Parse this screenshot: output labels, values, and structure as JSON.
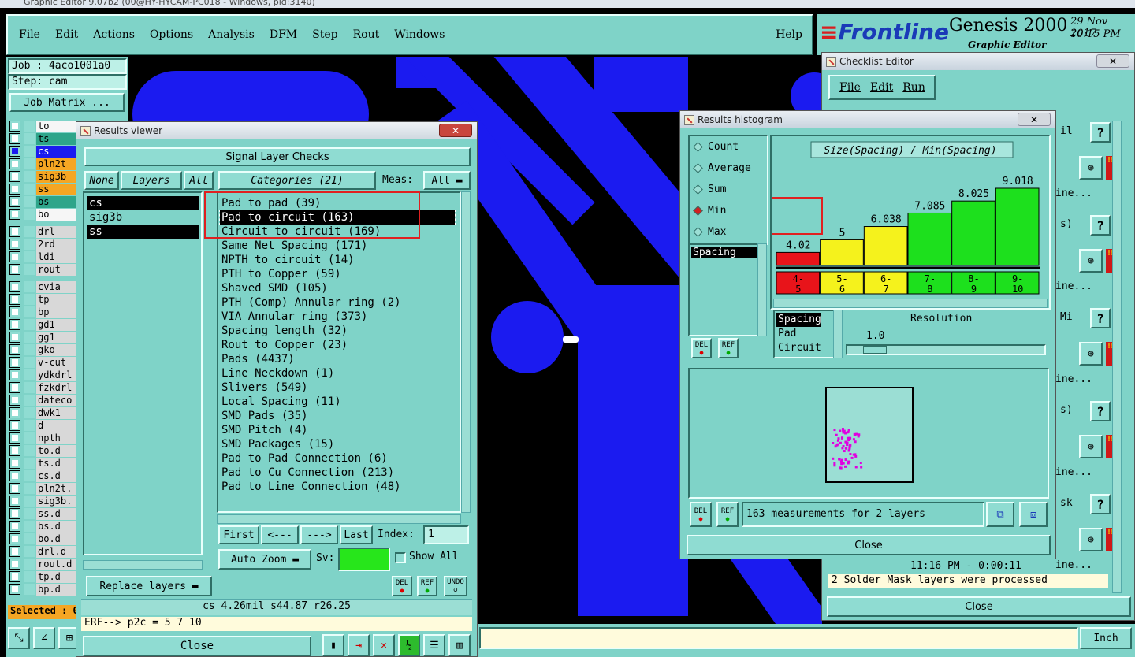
{
  "app": {
    "title": "Graphic Editor 9.07b2 (00@HY-HYCAM-PC018 - Windows, pid:3140)",
    "menu": [
      "File",
      "Edit",
      "Actions",
      "Options",
      "Analysis",
      "DFM",
      "Step",
      "Rout",
      "Windows"
    ],
    "help": "Help",
    "brand": "Frontline",
    "product": "Genesis 2000",
    "subtitle": "Graphic Editor",
    "date": "29 Nov 2017",
    "time": "10:15 PM"
  },
  "job": {
    "job": "Job : 4aco1001a0",
    "step": "Step: cam",
    "matrix_btn": "Job Matrix ..."
  },
  "layers": [
    {
      "name": "to",
      "color": "#f6f6f6",
      "sel": false
    },
    {
      "name": "ts",
      "color": "#2ea58a",
      "sel": false
    },
    {
      "name": "cs",
      "color": "#f5a623",
      "sel": true
    },
    {
      "name": "pln2t",
      "color": "#f5a623",
      "sel": false
    },
    {
      "name": "sig3b",
      "color": "#f5a623",
      "sel": false
    },
    {
      "name": "ss",
      "color": "#f5a623",
      "sel": false
    },
    {
      "name": "bs",
      "color": "#2ea58a",
      "sel": false
    },
    {
      "name": "bo",
      "color": "#f6f6f6",
      "sel": false
    },
    {
      "name": "drl",
      "color": "#d8d8d8",
      "sel": false
    },
    {
      "name": "2rd",
      "color": "#d8d8d8",
      "sel": false
    },
    {
      "name": "ldi",
      "color": "#d8d8d8",
      "sel": false
    },
    {
      "name": "rout",
      "color": "#d8d8d8",
      "sel": false
    },
    {
      "name": "cvia",
      "color": "#d8d8d8",
      "sel": false
    },
    {
      "name": "tp",
      "color": "#d8d8d8",
      "sel": false
    },
    {
      "name": "bp",
      "color": "#d8d8d8",
      "sel": false
    },
    {
      "name": "gd1",
      "color": "#d8d8d8",
      "sel": false
    },
    {
      "name": "gg1",
      "color": "#d8d8d8",
      "sel": false
    },
    {
      "name": "gko",
      "color": "#d8d8d8",
      "sel": false
    },
    {
      "name": "v-cut",
      "color": "#d8d8d8",
      "sel": false
    },
    {
      "name": "ydkdrl",
      "color": "#d8d8d8",
      "sel": false
    },
    {
      "name": "fzkdrl",
      "color": "#d8d8d8",
      "sel": false
    },
    {
      "name": "dateco",
      "color": "#d8d8d8",
      "sel": false
    },
    {
      "name": "dwk1",
      "color": "#d8d8d8",
      "sel": false
    },
    {
      "name": "d",
      "color": "#d8d8d8",
      "sel": false
    },
    {
      "name": "npth",
      "color": "#d8d8d8",
      "sel": false
    },
    {
      "name": "to.d",
      "color": "#d8d8d8",
      "sel": false
    },
    {
      "name": "ts.d",
      "color": "#d8d8d8",
      "sel": false
    },
    {
      "name": "cs.d",
      "color": "#d8d8d8",
      "sel": false
    },
    {
      "name": "pln2t.",
      "color": "#d8d8d8",
      "sel": false
    },
    {
      "name": "sig3b.",
      "color": "#d8d8d8",
      "sel": false
    },
    {
      "name": "ss.d",
      "color": "#d8d8d8",
      "sel": false
    },
    {
      "name": "bs.d",
      "color": "#d8d8d8",
      "sel": false
    },
    {
      "name": "bo.d",
      "color": "#d8d8d8",
      "sel": false
    },
    {
      "name": "drl.d",
      "color": "#d8d8d8",
      "sel": false
    },
    {
      "name": "rout.d",
      "color": "#d8d8d8",
      "sel": false
    },
    {
      "name": "tp.d",
      "color": "#d8d8d8",
      "sel": false
    },
    {
      "name": "bp.d",
      "color": "#d8d8d8",
      "sel": false
    }
  ],
  "selected_label": "Selected : 0",
  "results_viewer": {
    "title": "Results viewer",
    "header": "Signal Layer Checks",
    "none": "None",
    "layers": "Layers",
    "all": "All",
    "categories_btn": "Categories (21)",
    "meas_label": "Meas:",
    "meas_value": "All",
    "layer_list": [
      "cs",
      "sig3b",
      "ss"
    ],
    "categories": [
      "Pad to pad (39)",
      "Pad to circuit (163)",
      "Circuit to circuit (169)",
      "Same Net Spacing (171)",
      "NPTH to circuit (14)",
      "PTH to Copper (59)",
      "Shaved SMD (105)",
      "PTH (Comp) Annular ring (2)",
      "VIA Annular ring (373)",
      "Spacing length (32)",
      "Rout to Copper (23)",
      "Pads (4437)",
      "Line Neckdown (1)",
      "Slivers (549)",
      "Local Spacing (11)",
      "SMD Pads (35)",
      "SMD Pitch (4)",
      "SMD Packages (15)",
      "Pad to Pad Connection (6)",
      "Pad to Cu Connection (213)",
      "Pad to Line Connection (48)"
    ],
    "selected_category": 1,
    "first": "First",
    "prev": "<---",
    "next": "--->",
    "last": "Last",
    "index_label": "Index:",
    "index_value": "1",
    "autozoom": "Auto Zoom",
    "sv_label": "Sv:",
    "show_all": "Show All",
    "replace": "Replace layers",
    "del": "DEL",
    "ref": "REF",
    "undo": "UNDO",
    "status": "cs 4.26mil  s44.87  r26.25",
    "erf": "ERF--> p2c = 5 7 10",
    "close": "Close"
  },
  "histogram": {
    "title": "Results histogram",
    "modes": [
      "Count",
      "Average",
      "Sum",
      "Min",
      "Max"
    ],
    "selected_mode": "Min",
    "attr_list": [
      "Spacing"
    ],
    "chart_title": "Size(Spacing) / Min(Spacing)",
    "res_list": [
      "Spacing",
      "Pad",
      "Circuit"
    ],
    "resolution_label": "Resolution",
    "resolution_value": "1.0",
    "measurements": "163 measurements for 2 layers",
    "del": "DEL",
    "ref": "REF",
    "close": "Close"
  },
  "chart_data": {
    "type": "bar",
    "title": "Size(Spacing) / Min(Spacing)",
    "categories": [
      "4-5",
      "5-6",
      "6-7",
      "7-8",
      "8-9",
      "9-10"
    ],
    "values": [
      4.02,
      5,
      6.038,
      7.085,
      8.025,
      9.018
    ],
    "value_labels": [
      "4.02",
      "5",
      "6.038",
      "7.085",
      "8.025",
      "9.018"
    ],
    "colors": [
      "#e8141a",
      "#f5f21c",
      "#f5f21c",
      "#1de01d",
      "#1de01d",
      "#1de01d"
    ],
    "ylim": [
      0,
      10
    ]
  },
  "checklist": {
    "title": "Checklist Editor",
    "menu": [
      "File",
      "Edit",
      "Run"
    ],
    "row_texts": [
      "il",
      "ine...",
      "s)",
      "ine...",
      "Mi",
      "ine...",
      "s)",
      "ine...",
      "sk",
      "ine..."
    ],
    "time": "11:16 PM - 0:00:11",
    "msg": "2 Solder Mask layers were processed",
    "close": "Close"
  },
  "bottom": {
    "units": "Inch"
  }
}
